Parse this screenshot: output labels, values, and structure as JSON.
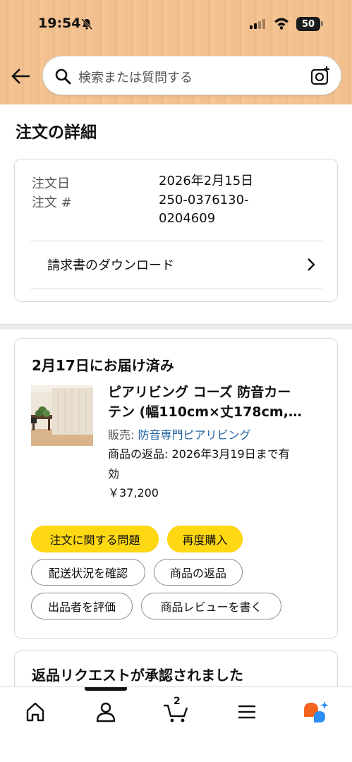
{
  "status_bar": {
    "time": "19:54",
    "battery": "50"
  },
  "search": {
    "placeholder": "検索または質問する"
  },
  "page": {
    "title": "注文の詳細"
  },
  "order": {
    "date_label": "注文日",
    "date_value": "2026年2月15日",
    "number_label": "注文 #",
    "number_value_line1": "250-0376130-",
    "number_value_line2": "0204609",
    "invoice_link": "請求書のダウンロード"
  },
  "shipment": {
    "status": "2月17日にお届け済み",
    "product_title_line1": "ピアリビング コーズ 防音カー",
    "product_title_line2": "テン (幅110cm×丈178cm,…",
    "seller_prefix": "販売: ",
    "seller_name": "防音専門ピアリビング",
    "return_line1": "商品の返品: 2026年3月19日まで有",
    "return_line2": "効",
    "price": "￥37,200",
    "buttons": {
      "order_issue": "注文に関する問題",
      "buy_again": "再度購入",
      "track": "配送状況を確認",
      "return": "商品の返品",
      "rate_seller": "出品者を評価",
      "write_review": "商品レビューを書く"
    }
  },
  "return_request": {
    "title": "返品リクエストが承認されました"
  },
  "nav": {
    "cart_count": "2"
  },
  "colors": {
    "header": "#f2c08f",
    "yellow_button": "#ffd814",
    "link": "#2162a1",
    "assistant_orange": "#f5621e",
    "assistant_blue": "#2c8ef7"
  }
}
